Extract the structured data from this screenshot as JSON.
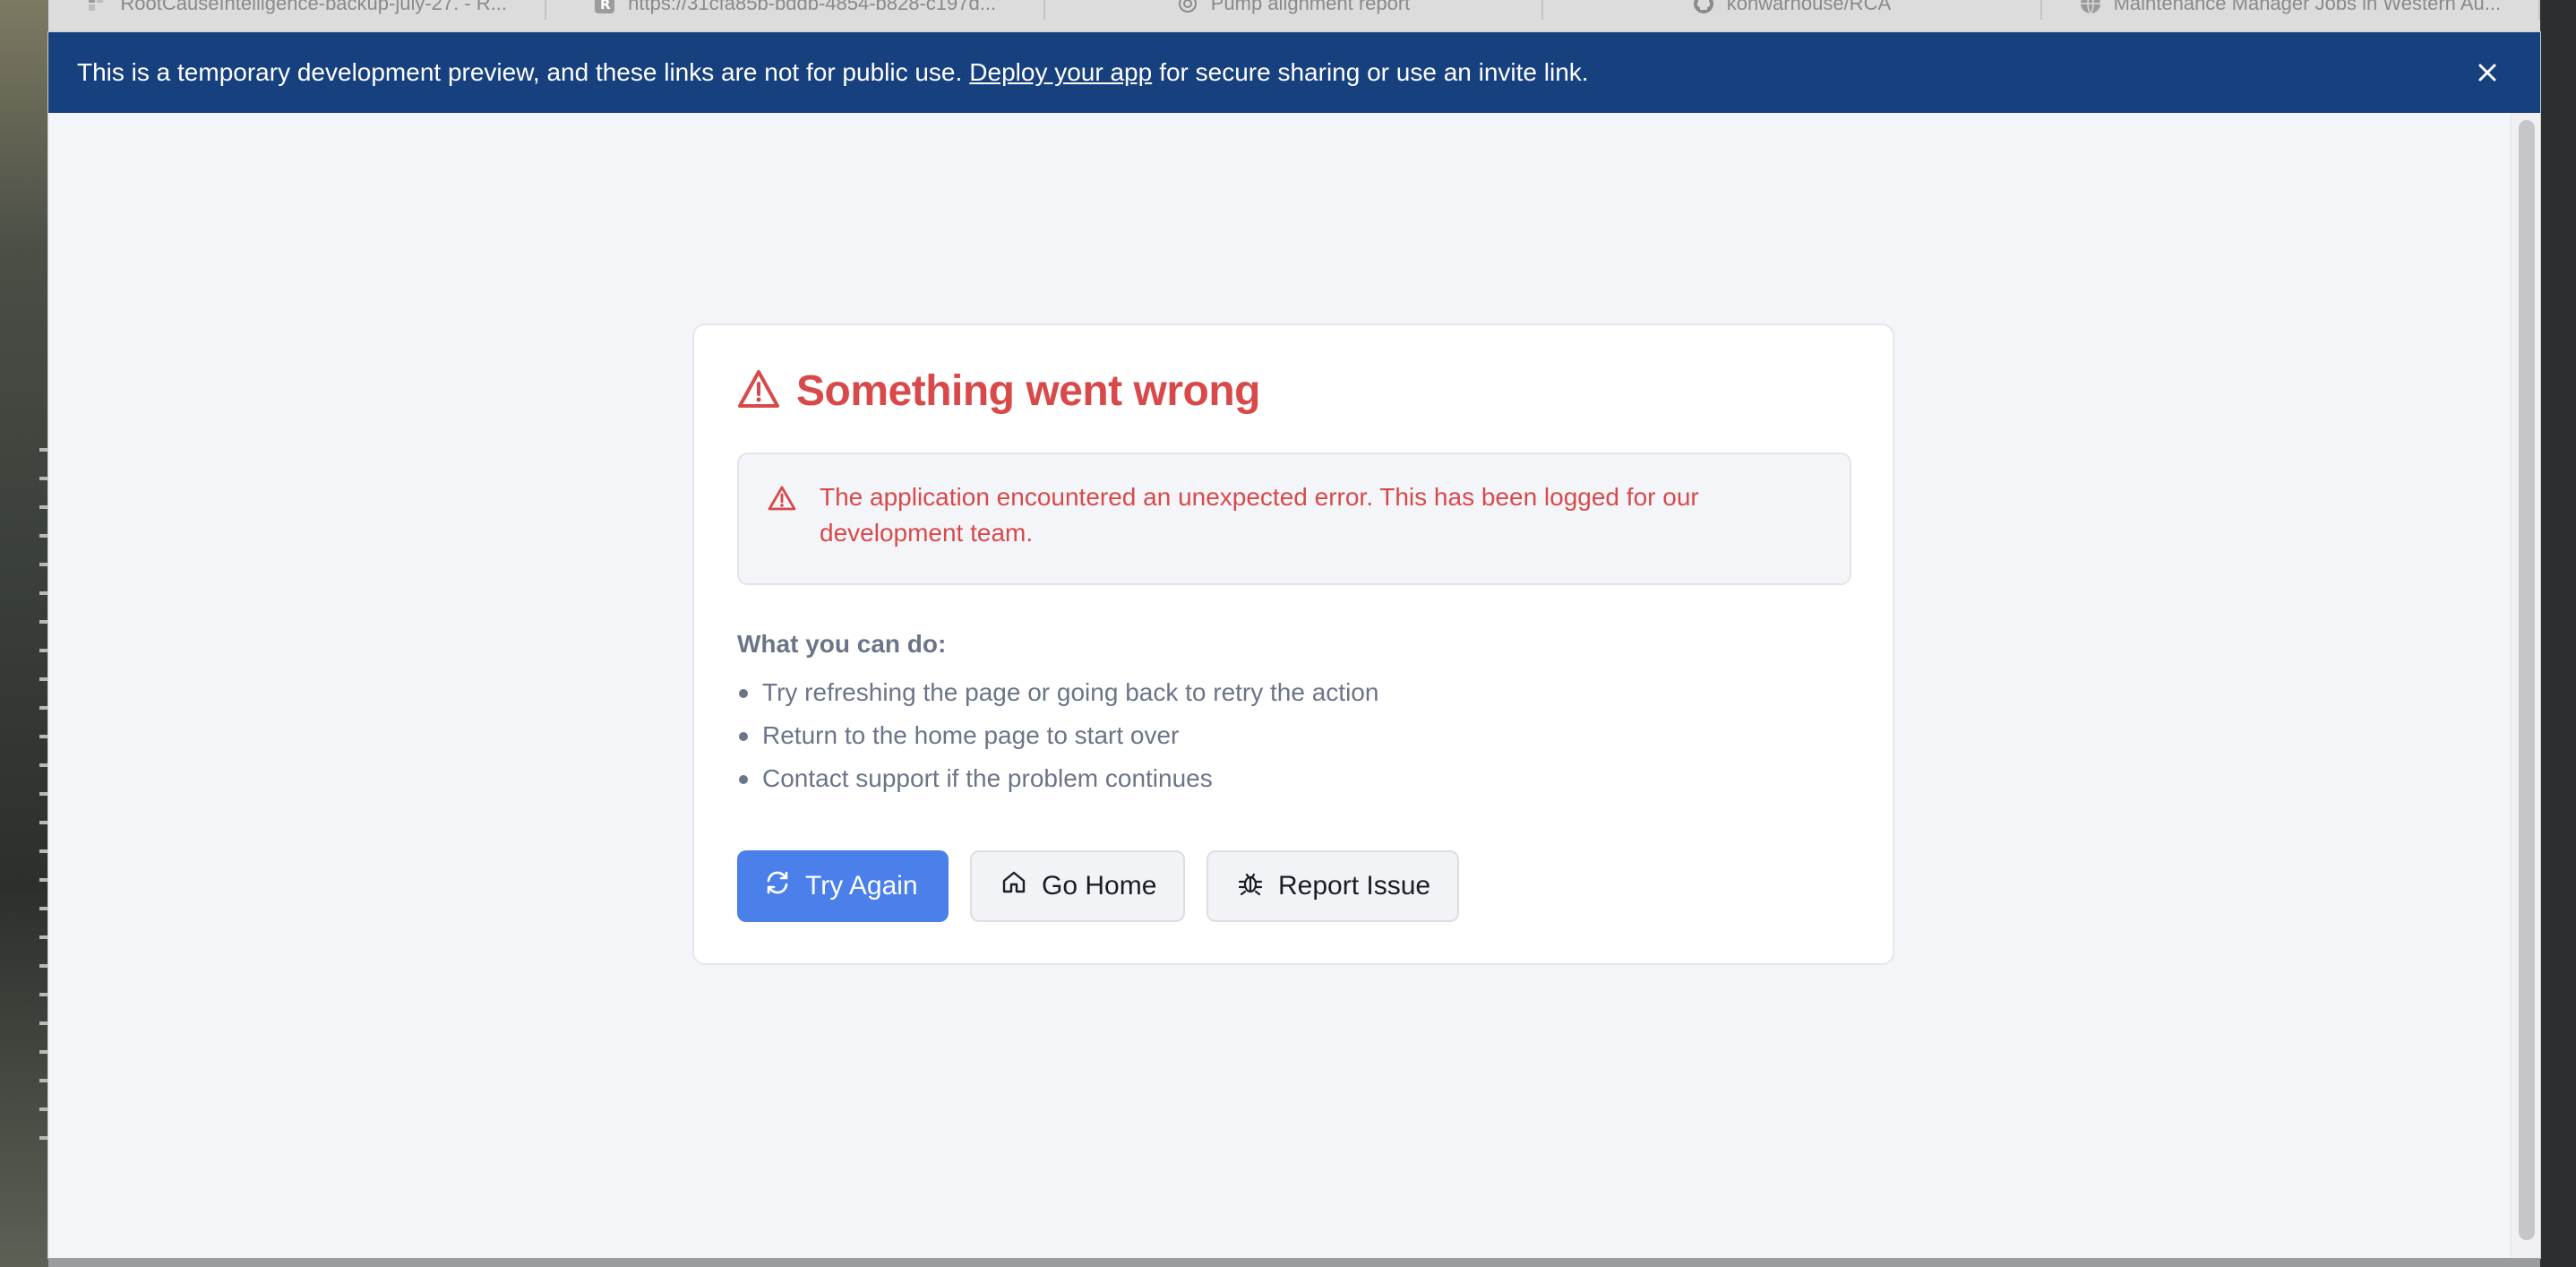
{
  "tabs": [
    {
      "label": "RootCauseIntelligence-backup-july-27. - R...",
      "icon": "app-icon"
    },
    {
      "label": "https://31cfa85b-bddb-4854-b828-c197d...",
      "icon": "r-icon"
    },
    {
      "label": "Pump alignment report",
      "icon": "openai-icon"
    },
    {
      "label": "konwarhouse/RCA",
      "icon": "github-icon"
    },
    {
      "label": "Maintenance Manager Jobs in Western Au...",
      "icon": "globe-icon"
    }
  ],
  "banner": {
    "text_before": "This is a temporary development preview, and these links are not for public use.",
    "link": "Deploy your app",
    "text_after": "for secure sharing or use an invite link.",
    "bg_color": "#17407f"
  },
  "error": {
    "title": "Something went wrong",
    "message": "The application encountered an unexpected error. This has been logged for our development team.",
    "subtitle": "What you can do:",
    "suggestions": [
      "Try refreshing the page or going back to retry the action",
      "Return to the home page to start over",
      "Contact support if the problem continues"
    ],
    "accent_color": "#d84a4a"
  },
  "buttons": {
    "try_again": "Try Again",
    "go_home": "Go Home",
    "report_issue": "Report Issue",
    "primary_color": "#4b7fea"
  }
}
